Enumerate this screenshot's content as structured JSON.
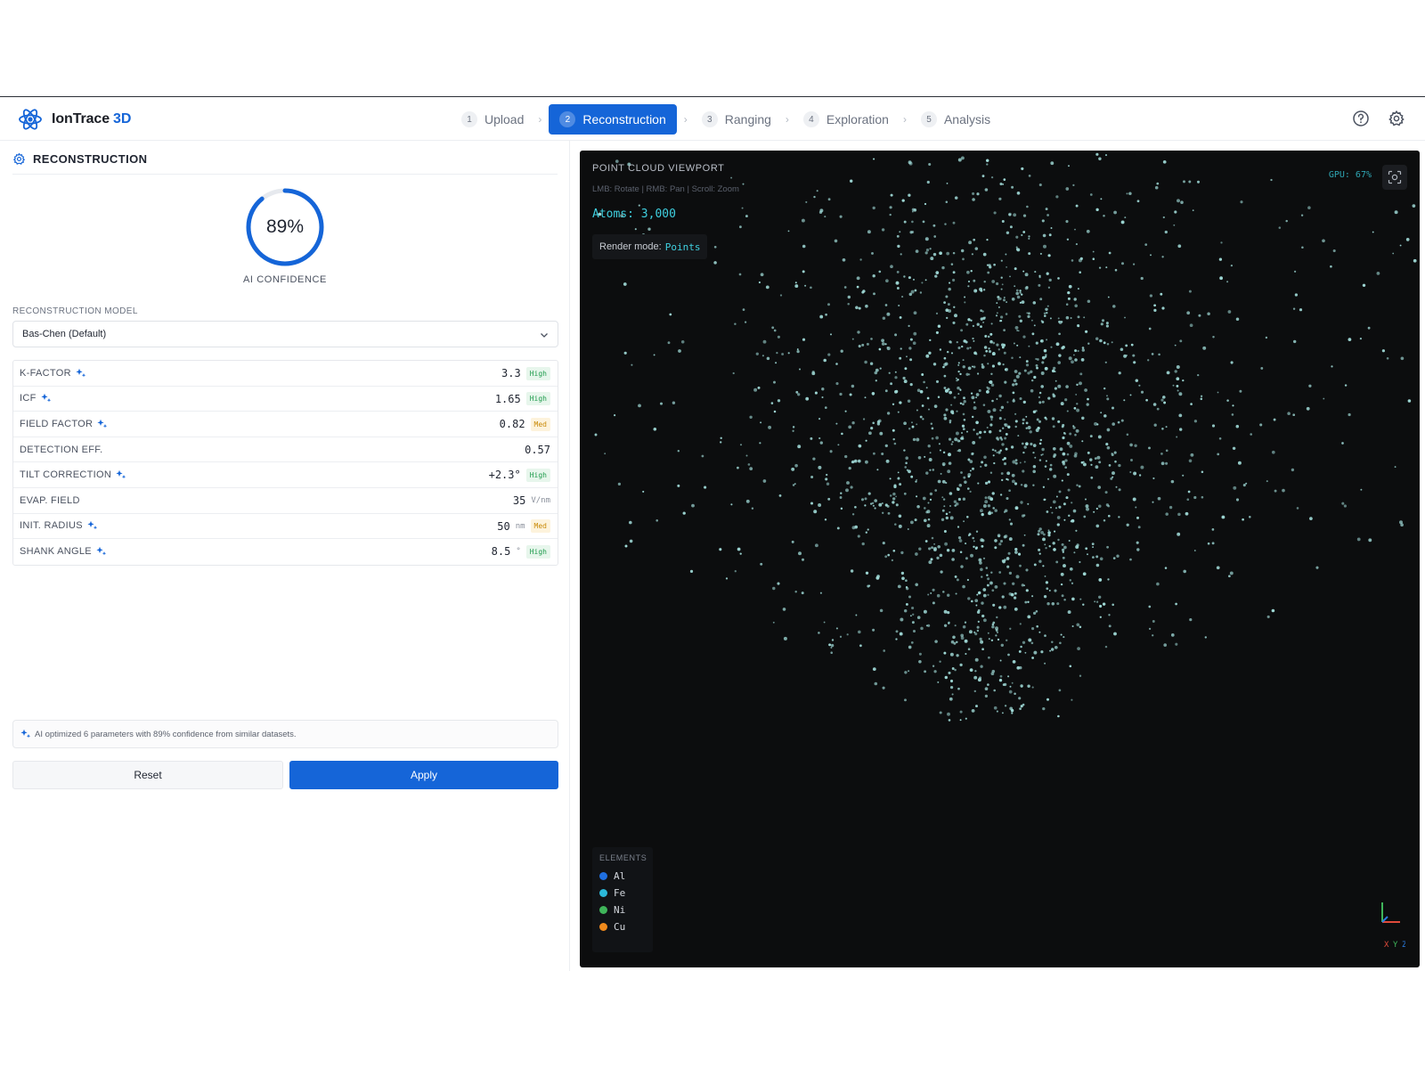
{
  "app": {
    "name": "IonTrace",
    "name_suffix": "3D",
    "accent_color": "#1565d8"
  },
  "steps": [
    {
      "num": "1",
      "label": "Upload",
      "active": false
    },
    {
      "num": "2",
      "label": "Reconstruction",
      "active": true
    },
    {
      "num": "3",
      "label": "Ranging",
      "active": false
    },
    {
      "num": "4",
      "label": "Exploration",
      "active": false
    },
    {
      "num": "5",
      "label": "Analysis",
      "active": false
    }
  ],
  "header_icons": [
    "help-circle-icon",
    "gear-icon"
  ],
  "panel": {
    "title": "RECONSTRUCTION",
    "confidence": {
      "value": 0.89,
      "text": "89%",
      "label": "AI CONFIDENCE"
    },
    "model": {
      "label": "RECONSTRUCTION MODEL",
      "selected": "Bas-Chen (Default)"
    },
    "params": [
      {
        "name": "K-FACTOR",
        "ai": true,
        "value": "3.3",
        "unit": "",
        "badge": "High"
      },
      {
        "name": "ICF",
        "ai": true,
        "value": "1.65",
        "unit": "",
        "badge": "High"
      },
      {
        "name": "FIELD FACTOR",
        "ai": true,
        "value": "0.82",
        "unit": "",
        "badge": "Med"
      },
      {
        "name": "DETECTION EFF.",
        "ai": false,
        "value": "0.57",
        "unit": "",
        "badge": ""
      },
      {
        "name": "TILT CORRECTION",
        "ai": true,
        "value": "+2.3°",
        "unit": "",
        "badge": "High"
      },
      {
        "name": "EVAP. FIELD",
        "ai": false,
        "value": "35",
        "unit": "V/nm",
        "badge": ""
      },
      {
        "name": "INIT. RADIUS",
        "ai": true,
        "value": "50",
        "unit": "nm",
        "badge": "Med"
      },
      {
        "name": "SHANK ANGLE",
        "ai": true,
        "value": "8.5",
        "unit": "°",
        "badge": "High"
      }
    ],
    "ai_note": "AI optimized 6 parameters with 89% confidence from similar datasets.",
    "reset_label": "Reset",
    "apply_label": "Apply"
  },
  "viewport": {
    "title": "POINT CLOUD VIEWPORT",
    "controls": "LMB: Rotate | RMB: Pan | Scroll: Zoom",
    "atoms_text": "Atoms: 3,000",
    "atom_count": 3000,
    "render_label": "Render mode:",
    "render_mode": "Points",
    "gpu_text": "GPU: 67%",
    "point_color": "#9fd9d6",
    "legend_title": "ELEMENTS",
    "elements": [
      {
        "name": "Al",
        "color": "#1f6fe0"
      },
      {
        "name": "Fe",
        "color": "#2bb8d8"
      },
      {
        "name": "Ni",
        "color": "#3fb55a"
      },
      {
        "name": "Cu",
        "color": "#f08a1c"
      }
    ],
    "axes": {
      "x": "X",
      "y": "Y",
      "z": "Z"
    }
  }
}
